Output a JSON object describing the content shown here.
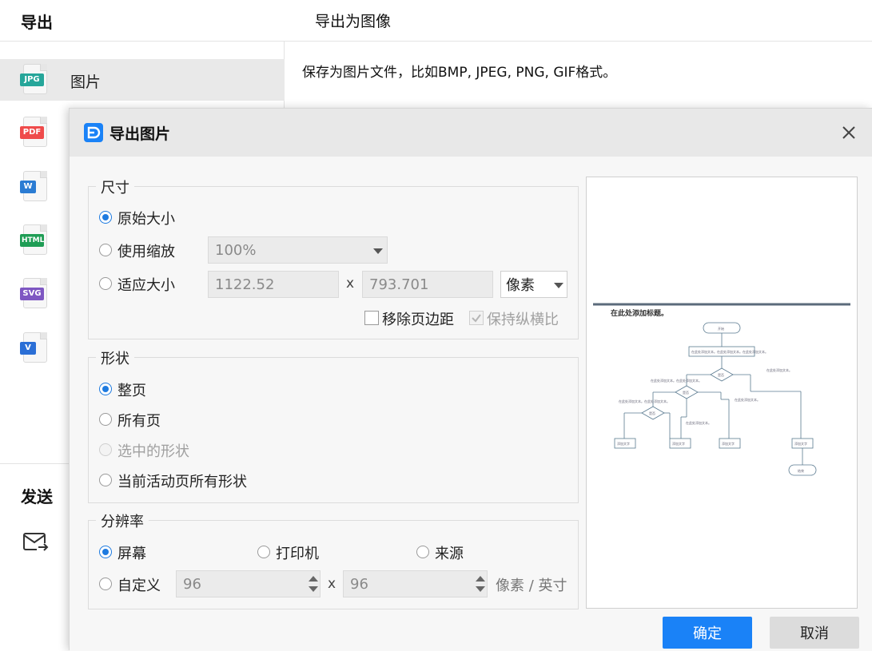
{
  "app": {
    "left_title": "导出",
    "main_title": "导出为图像",
    "description": "保存为图片文件，比如BMP, JPEG, PNG, GIF格式。",
    "nav": [
      {
        "label": "图片",
        "tag": "JPG",
        "color": "#26a69a"
      },
      {
        "label": "",
        "tag": "PDF",
        "color": "#ef4b4b"
      },
      {
        "label": "",
        "tag": "W",
        "color": "#2b7cd3"
      },
      {
        "label": "",
        "tag": "HTML",
        "color": "#1f9d55"
      },
      {
        "label": "",
        "tag": "SVG",
        "color": "#7e57c2"
      },
      {
        "label": "",
        "tag": "V",
        "color": "#2b6fd6"
      }
    ],
    "send_title": "发送"
  },
  "dialog": {
    "title": "导出图片",
    "size": {
      "legend": "尺寸",
      "original": "原始大小",
      "use_scale": "使用缩放",
      "scale_value": "100%",
      "fit_size": "适应大小",
      "width": "1122.52",
      "x": "x",
      "height": "793.701",
      "unit": "像素",
      "remove_margin": "移除页边距",
      "keep_ratio": "保持纵横比"
    },
    "shape": {
      "legend": "形状",
      "whole_page": "整页",
      "all_pages": "所有页",
      "selected": "选中的形状",
      "current_all": "当前活动页所有形状"
    },
    "resolution": {
      "legend": "分辨率",
      "screen": "屏幕",
      "printer": "打印机",
      "source": "来源",
      "custom": "自定义",
      "dpi_x": "96",
      "x": "x",
      "dpi_y": "96",
      "unit": "像素 / 英寸"
    },
    "ok": "确定",
    "cancel": "取消"
  },
  "preview": {
    "heading": "在此处添加标题。",
    "start": "开始",
    "process_top": "在此处添加文本。在此处添加文本。在此处添加文本。",
    "decision": "是否",
    "note_right": "在此处添加文本。",
    "note_left": "在此处添加文本。在此处添加文本。",
    "note_far_left": "在此处添加文本。在此处添加文本。",
    "note_mid": "在此处添加文本。",
    "note_lower": "在此处添加文本。",
    "box": "添加文字",
    "end": "结束"
  },
  "colors": {
    "primary": "#1a82f7",
    "accent_radio": "#1e7be0"
  }
}
